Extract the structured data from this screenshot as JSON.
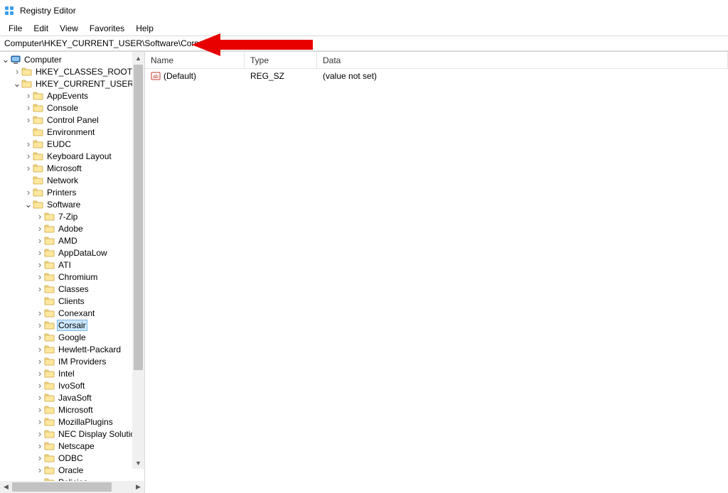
{
  "window": {
    "title": "Registry Editor"
  },
  "menu": {
    "items": [
      "File",
      "Edit",
      "View",
      "Favorites",
      "Help"
    ]
  },
  "address": {
    "path": "Computer\\HKEY_CURRENT_USER\\Software\\Corsair"
  },
  "tree": {
    "root": {
      "label": "Computer",
      "expanded": true
    },
    "hives": [
      {
        "label": "HKEY_CLASSES_ROOT",
        "hasChildren": true,
        "expanded": false
      },
      {
        "label": "HKEY_CURRENT_USER",
        "hasChildren": true,
        "expanded": true
      }
    ],
    "hkcu_children": [
      {
        "label": "AppEvents",
        "hasChildren": true
      },
      {
        "label": "Console",
        "hasChildren": true
      },
      {
        "label": "Control Panel",
        "hasChildren": true
      },
      {
        "label": "Environment",
        "hasChildren": false
      },
      {
        "label": "EUDC",
        "hasChildren": true
      },
      {
        "label": "Keyboard Layout",
        "hasChildren": true
      },
      {
        "label": "Microsoft",
        "hasChildren": true
      },
      {
        "label": "Network",
        "hasChildren": false
      },
      {
        "label": "Printers",
        "hasChildren": true
      },
      {
        "label": "Software",
        "hasChildren": true,
        "expanded": true
      }
    ],
    "software_children": [
      {
        "label": "7-Zip",
        "hasChildren": true
      },
      {
        "label": "Adobe",
        "hasChildren": true
      },
      {
        "label": "AMD",
        "hasChildren": true
      },
      {
        "label": "AppDataLow",
        "hasChildren": true
      },
      {
        "label": "ATI",
        "hasChildren": true
      },
      {
        "label": "Chromium",
        "hasChildren": true
      },
      {
        "label": "Classes",
        "hasChildren": true
      },
      {
        "label": "Clients",
        "hasChildren": false
      },
      {
        "label": "Conexant",
        "hasChildren": true
      },
      {
        "label": "Corsair",
        "hasChildren": true,
        "selected": true
      },
      {
        "label": "Google",
        "hasChildren": true
      },
      {
        "label": "Hewlett-Packard",
        "hasChildren": true
      },
      {
        "label": "IM Providers",
        "hasChildren": true
      },
      {
        "label": "Intel",
        "hasChildren": true
      },
      {
        "label": "IvoSoft",
        "hasChildren": true
      },
      {
        "label": "JavaSoft",
        "hasChildren": true
      },
      {
        "label": "Microsoft",
        "hasChildren": true
      },
      {
        "label": "MozillaPlugins",
        "hasChildren": true
      },
      {
        "label": "NEC Display Solutions",
        "hasChildren": true
      },
      {
        "label": "Netscape",
        "hasChildren": true
      },
      {
        "label": "ODBC",
        "hasChildren": true
      },
      {
        "label": "Oracle",
        "hasChildren": true
      },
      {
        "label": "Policies",
        "hasChildren": true
      }
    ]
  },
  "list": {
    "columns": [
      "Name",
      "Type",
      "Data"
    ],
    "rows": [
      {
        "name": "(Default)",
        "type": "REG_SZ",
        "data": "(value not set)"
      }
    ]
  }
}
